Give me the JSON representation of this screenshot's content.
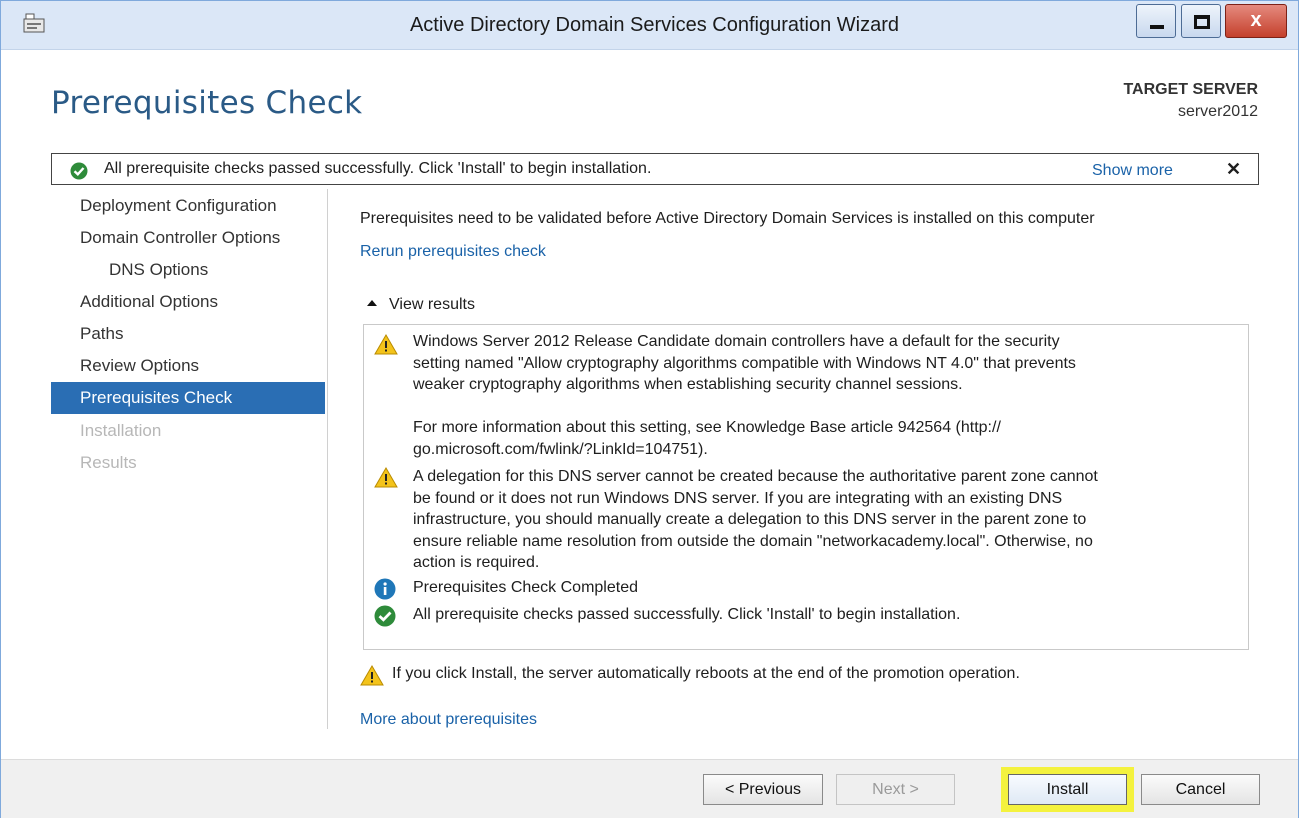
{
  "window": {
    "title": "Active Directory Domain Services Configuration Wizard",
    "minimize_icon": "minimize-icon",
    "maximize_icon": "maximize-icon",
    "close_glyph": "x"
  },
  "header": {
    "page_title": "Prerequisites Check",
    "target_label": "TARGET SERVER",
    "target_value": "server2012"
  },
  "notification": {
    "icon": "success-check-icon",
    "text": "All prerequisite checks passed successfully.  Click 'Install' to begin installation.",
    "show_more": "Show more",
    "close": "✕"
  },
  "sidebar": {
    "items": [
      {
        "label": "Deployment Configuration",
        "state": "normal"
      },
      {
        "label": "Domain Controller Options",
        "state": "normal"
      },
      {
        "label": "DNS Options",
        "state": "sub"
      },
      {
        "label": "Additional Options",
        "state": "normal"
      },
      {
        "label": "Paths",
        "state": "normal"
      },
      {
        "label": "Review Options",
        "state": "normal"
      },
      {
        "label": "Prerequisites Check",
        "state": "active"
      },
      {
        "label": "Installation",
        "state": "disabled"
      },
      {
        "label": "Results",
        "state": "disabled"
      }
    ]
  },
  "main": {
    "intro": "Prerequisites need to be validated before Active Directory Domain Services is installed on this computer",
    "rerun_link": "Rerun prerequisites check",
    "view_results": "View results",
    "results": [
      {
        "icon": "warning-icon",
        "lines": [
          "Windows Server 2012 Release Candidate domain controllers have a default for the security",
          "setting named \"Allow cryptography algorithms compatible with Windows NT 4.0\" that prevents",
          "weaker cryptography algorithms when establishing security channel sessions."
        ]
      },
      {
        "icon": "",
        "lines": [
          "For more information about this setting, see Knowledge Base article 942564 (http://",
          "go.microsoft.com/fwlink/?LinkId=104751)."
        ]
      },
      {
        "icon": "warning-icon",
        "lines": [
          "A delegation for this DNS server cannot be created because the authoritative parent zone cannot",
          "be found or it does not run Windows DNS server. If you are integrating with an existing DNS",
          "infrastructure, you should manually create a delegation to this DNS server in the parent zone to",
          "ensure reliable name resolution from outside the domain \"networkacademy.local\". Otherwise, no",
          "action is required."
        ]
      },
      {
        "icon": "info-icon",
        "lines": [
          "Prerequisites Check Completed"
        ]
      },
      {
        "icon": "success-check-icon",
        "lines": [
          "All prerequisite checks passed successfully.  Click 'Install' to begin installation."
        ]
      }
    ],
    "reboot_warning": "If you click Install, the server automatically reboots at the end of the promotion operation.",
    "more_link": "More about prerequisites"
  },
  "footer": {
    "previous": "< Previous",
    "next": "Next >",
    "install": "Install",
    "cancel": "Cancel"
  },
  "colors": {
    "accent": "#2a6eb4",
    "link": "#1a62a8",
    "title": "#2a5a86",
    "highlight": "#f4f23e",
    "warning": "#f3c31b",
    "info": "#1f77b8",
    "success": "#2e8b3a"
  }
}
